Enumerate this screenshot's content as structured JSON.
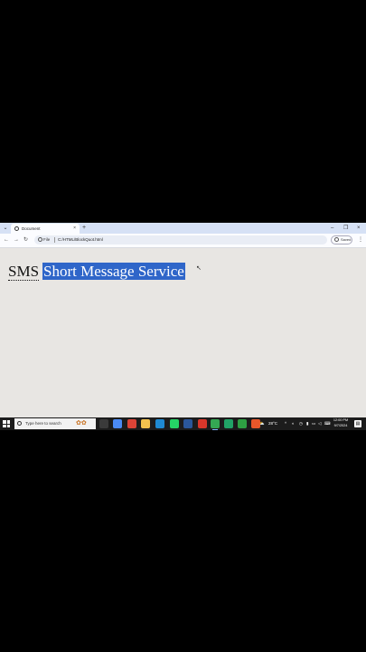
{
  "browser": {
    "tab_title": "Document",
    "tab_close": "×",
    "new_tab": "+",
    "tab_menu_glyph": "⌄",
    "win_min": "–",
    "win_max": "❐",
    "win_close": "×",
    "back": "←",
    "forward": "→",
    "reload": "↻",
    "address_scheme": "File",
    "address_url": "C:/HTML/BlockQuot.html",
    "saved_label": "Saved",
    "menu_glyph": "⋮"
  },
  "page": {
    "abbr_text": "SMS",
    "highlighted_text": "Short Message Service"
  },
  "taskbar": {
    "search_placeholder": "Type here to search",
    "weather_temp": "28°C",
    "clock_time": "12:00 PM",
    "clock_date": "9/7/2024",
    "apps": [
      {
        "name": "task-view-icon",
        "color": "#3a3a3a"
      },
      {
        "name": "chrome-icon",
        "color": "#4a8af4"
      },
      {
        "name": "chrome-alt-icon",
        "color": "#db4437"
      },
      {
        "name": "file-explorer-icon",
        "color": "#f2c14e"
      },
      {
        "name": "vscode-icon",
        "color": "#1f8ad2"
      },
      {
        "name": "whatsapp-icon",
        "color": "#25d366"
      },
      {
        "name": "app-blue-icon",
        "color": "#2b579a"
      },
      {
        "name": "app-red-icon",
        "color": "#d9372b"
      },
      {
        "name": "chrome-active-icon",
        "color": "#34a853"
      },
      {
        "name": "app-green-icon",
        "color": "#21a366"
      },
      {
        "name": "codeblocks-icon",
        "color": "#2ea043"
      },
      {
        "name": "app-orange-icon",
        "color": "#e8572a"
      }
    ]
  }
}
